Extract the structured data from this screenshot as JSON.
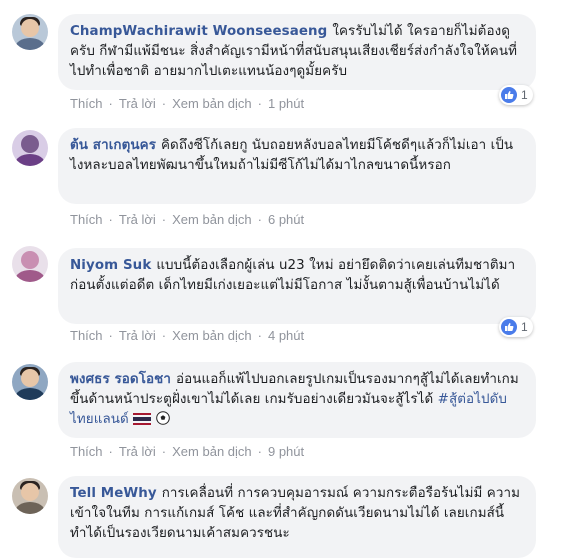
{
  "actions": {
    "like": "Thích",
    "reply": "Trả lời",
    "translate": "Xem bản dịch"
  },
  "comments": [
    {
      "author": "ChampWachirawit Woonseesaeng",
      "text": "ใครรับไม่ได้ ใครอายก็ไม่ต้องดูครับ กีฬามีแพ้มีชนะ สิ่งสำคัญเรามีหน้าที่สนับสนุนเสียงเชียร์ส่งกำลังใจให้คนที่ไปทำเพื่อชาติ อายมากไปเตะแทนน้องๆดูมั้ยครับ",
      "time": "1 phút",
      "likes": "1"
    },
    {
      "author": "ต้น สาเกตุนคร",
      "text": "คิดถึงซีโก้เลยกู นับถอยหลังบอลไทยมีโค้ชดีๆแล้วก็ไม่เอา เป็นไงหละบอลไทยพัฒนาขึ้นใหมถ้าไม่มีซีโก้ไม่ได้มาไกลขนาดนี้หรอก",
      "time": "6 phút"
    },
    {
      "author": "Niyom Suk",
      "text": "แบบนี้ต้องเลือกผู้เล่น u23 ใหม่ อย่ายึดติดว่าเคยเล่นทีมชาติมาก่อนตั้งแต่อดีต เด็กไทยมีเก่งเยอะแต่ไม่มีโอกาส ไม่งั้นตามสู้เพื่อนบ้านไม่ได้",
      "time": "4 phút",
      "likes": "1"
    },
    {
      "author": "พงศธร รอดโอชา",
      "text": "อ่อนแอก็แพ้ไปบอกเลยรูปเกมเป็นรองมากๆสู้ไม่ได้เลยทำเกมขึ้นด้านหน้าประตูฝั่งเขาไม่ได้เลย เกมรับอย่างเดียวมันจะสู้ไรได้",
      "hashtag": "#สู้ต่อไปดับไทยแลนด์",
      "time": "9 phút"
    },
    {
      "author": "Tell MeWhy",
      "text": "การเคลื่อนที่ การควบคุมอารมณ์ ความกระตือรือร้นไม่มี ความเข้าใจในทีม การแก้เกมส์ โค้ช และที่สำคัญกดดันเวียดนามไม่ได้ เลยเกมส์นี้ทำได้เป็นรองเวียดนามเค้าสมควรชนะ"
    }
  ],
  "colors": {
    "link": "#385898",
    "bubble": "#f2f3f5",
    "meta": "#90949c",
    "like": "#4a7cea"
  }
}
